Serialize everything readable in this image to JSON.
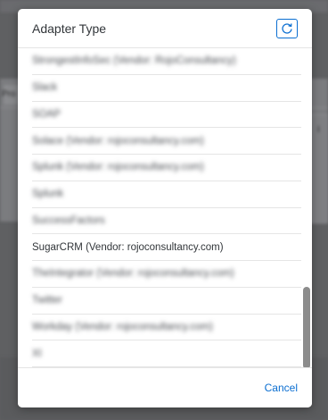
{
  "background": {
    "left_fragment": "Pro",
    "right_fragment": "I"
  },
  "dialog": {
    "title": "Adapter Type",
    "refresh_icon": "refresh-icon",
    "items": [
      {
        "label": "StrongestInfoSec (Vendor: RojoConsultancy)",
        "blurred": true
      },
      {
        "label": "Slack",
        "blurred": true
      },
      {
        "label": "SOAP",
        "blurred": true
      },
      {
        "label": "Solace (Vendor: rojoconsultancy.com)",
        "blurred": true
      },
      {
        "label": "Splunk (Vendor: rojoconsultancy.com)",
        "blurred": true
      },
      {
        "label": "Splunk",
        "blurred": true
      },
      {
        "label": "SuccessFactors",
        "blurred": true
      },
      {
        "label": "SugarCRM (Vendor: rojoconsultancy.com)",
        "blurred": false
      },
      {
        "label": "TheIntegrator (Vendor: rojoconsultancy.com)",
        "blurred": true
      },
      {
        "label": "Twitter",
        "blurred": true
      },
      {
        "label": "Workday (Vendor: rojoconsultancy.com)",
        "blurred": true
      },
      {
        "label": "XI",
        "blurred": true
      }
    ],
    "cancel_label": "Cancel"
  },
  "colors": {
    "accent": "#0a6ed1",
    "text": "#32363a",
    "overlay": "#5f6062"
  }
}
